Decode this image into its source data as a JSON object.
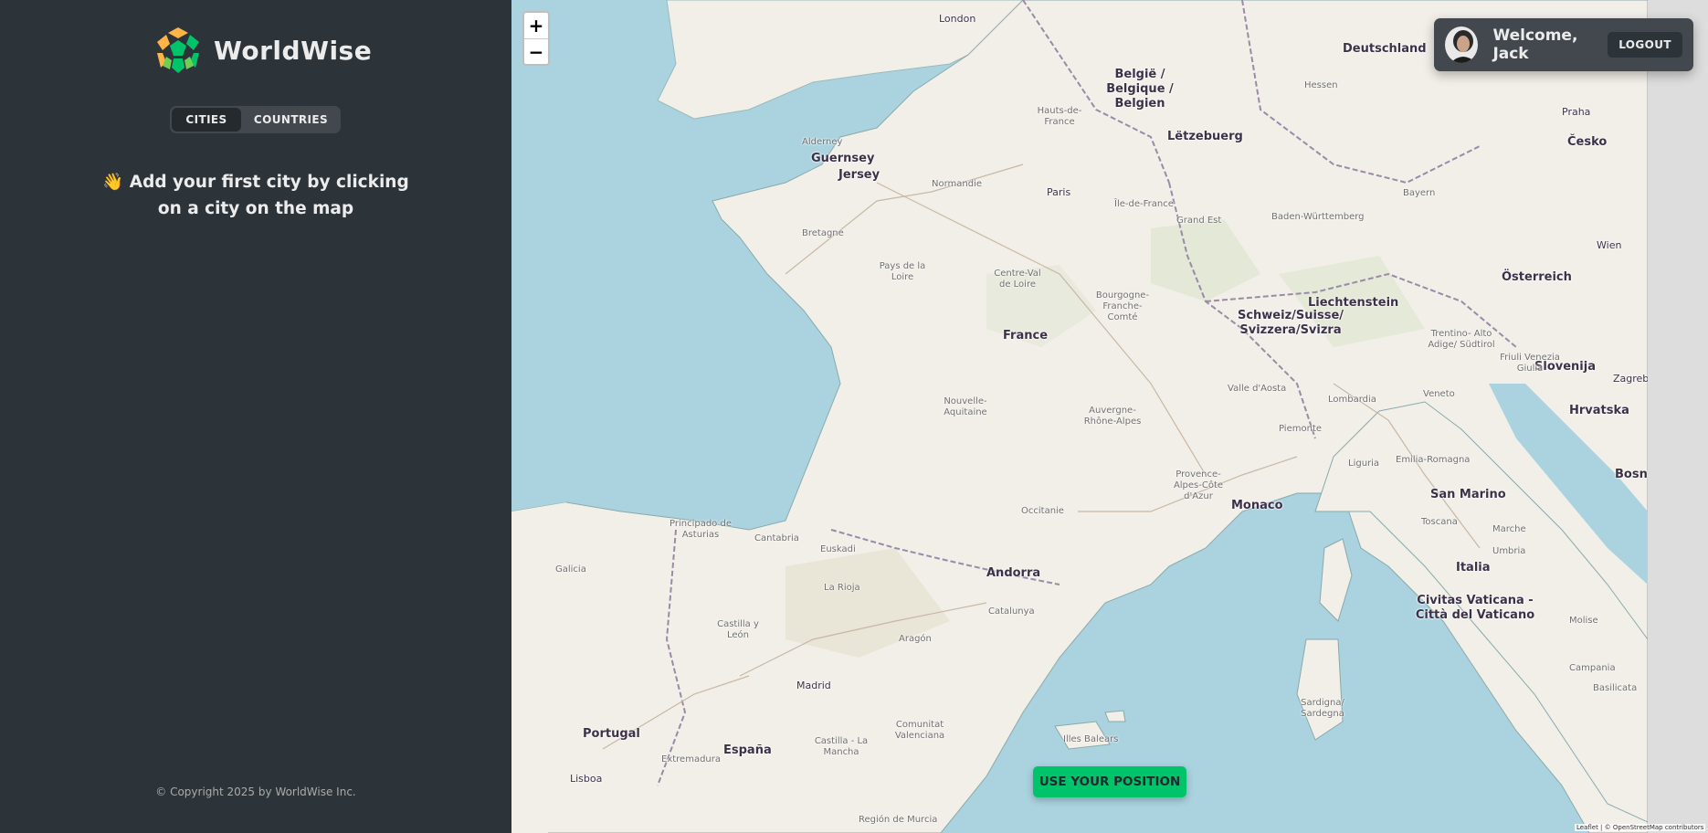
{
  "app": {
    "name": "WorldWise"
  },
  "tabs": [
    {
      "label": "CITIES",
      "active": true
    },
    {
      "label": "COUNTRIES",
      "active": false
    }
  ],
  "empty_message": "👋 Add your first city by clicking on a city on the map",
  "footer": {
    "copyright": "© Copyright 2025 by WorldWise Inc."
  },
  "user": {
    "welcome": "Welcome, Jack",
    "logout_label": "LOGOUT"
  },
  "map": {
    "zoom_in": "+",
    "zoom_out": "−",
    "use_position_label": "USE YOUR POSITION",
    "attribution": "Leaflet | © OpenStreetMap contributors",
    "labels": {
      "london": "London",
      "deutschland": "Deutschland",
      "belgie": "België / Belgique / Belgien",
      "letzebuerg": "Lëtzebuerg",
      "guernsey": "Guernsey",
      "jersey": "Jersey",
      "paris": "Paris",
      "france": "France",
      "praha": "Praha",
      "cesko": "Česko",
      "wien": "Wien",
      "osterreich": "Österreich",
      "liechtenstein": "Liechtenstein",
      "schweiz": "Schweiz/Suisse/ Svizzera/Svizra",
      "slovenija": "Slovenija",
      "zagreb": "Zagreb",
      "hrvatska": "Hrvatska",
      "monaco": "Monaco",
      "san_marino": "San Marino",
      "italia": "Italia",
      "vaticano": "Civitas Vaticana - Città del Vaticano",
      "andorra": "Andorra",
      "espana": "España",
      "madrid": "Madrid",
      "portugal": "Portugal",
      "lisboa": "Lisboa",
      "bosna": "Bosna",
      "bretagne": "Bretagne",
      "normandie": "Normandie",
      "pays_de_la_loire": "Pays de la Loire",
      "centre": "Centre-Val de Loire",
      "bourgogne": "Bourgogne- Franche- Comté",
      "nouvelle": "Nouvelle- Aquitaine",
      "auvergne": "Auvergne- Rhône-Alpes",
      "occitanie": "Occitanie",
      "provence": "Provence- Alpes-Côte d'Azur",
      "galicia": "Galicia",
      "principado": "Principado de Asturias",
      "castilla_leon": "Castilla y León",
      "aragon": "Aragón",
      "catalunya": "Catalunya",
      "illes_balears": "Illes Balears",
      "sardigna": "Sardigna/ Sardegna",
      "toscana": "Toscana",
      "lombardia": "Lombardia",
      "veneto": "Veneto",
      "grand_est": "Grand Est",
      "ile_de_france": "Île-de-France",
      "hauts_de_france": "Hauts-de- France",
      "bayern": "Bayern",
      "baden": "Baden-Württemberg",
      "hessen": "Hessen",
      "alderney": "Alderney",
      "piemonte": "Piemonte",
      "emilia": "Emilia-Romagna",
      "la_rioja": "La Rioja",
      "euskadi": "Euskadi",
      "cantabria": "Cantabria",
      "extremadura": "Extremadura",
      "castilla_mancha": "Castilla - La Mancha",
      "comunitat": "Comunitat Valenciana",
      "campania": "Campania",
      "marche": "Marche",
      "umbria": "Umbria",
      "molise": "Molise",
      "basilicata": "Basilicata",
      "friuli": "Friuli Venezia Giulia",
      "trentino": "Trentino- Alto Adige/ Südtirol",
      "valle_aosta": "Valle d'Aosta",
      "liguria": "Liguria",
      "region_murcia": "Región de Murcia"
    }
  },
  "colors": {
    "sidebar_bg": "#2d3439",
    "accent_green": "#00c46a",
    "sea": "#aad3df",
    "land": "#f2efe9"
  }
}
